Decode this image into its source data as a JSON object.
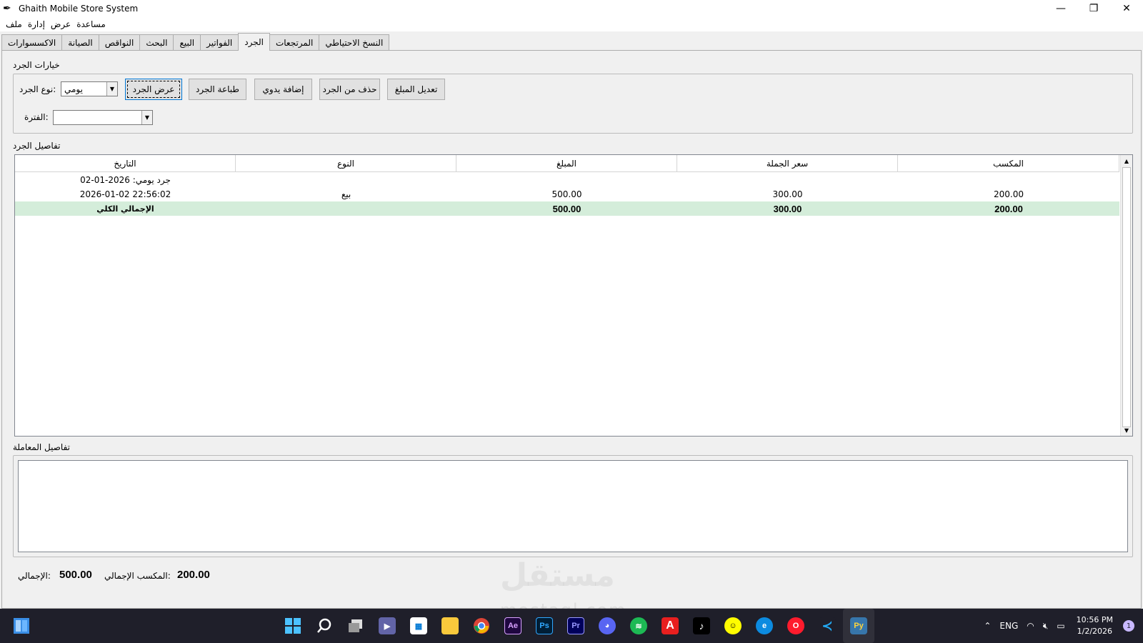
{
  "window": {
    "title": "Ghaith Mobile Store System"
  },
  "menu": [
    "ملف",
    "إدارة",
    "عرض",
    "مساعدة"
  ],
  "tabs": [
    "الاكسسوارات",
    "الصيانة",
    "النواقص",
    "البحث",
    "البيع",
    "الفواتير",
    "الجرد",
    "المرتجعات",
    "النسخ الاحتياطي"
  ],
  "options": {
    "group_label": "خيارات الجرد",
    "type_label": "نوع الجرد:",
    "type_value": "يومي",
    "period_label": "الفترة:",
    "period_value": "",
    "buttons": {
      "view": "عرض الجرد",
      "print": "طباعة الجرد",
      "add": "إضافة يدوي",
      "delete": "حذف من الجرد",
      "edit": "تعديل المبلغ"
    }
  },
  "details": {
    "group_label": "تفاصيل الجرد",
    "columns": [
      "التاريخ",
      "النوع",
      "المبلغ",
      "سعر الجملة",
      "المكسب"
    ],
    "rows": [
      {
        "date": "جرد يومي: 2026-01-02",
        "type": "",
        "amount": "",
        "wholesale": "",
        "profit": ""
      },
      {
        "date": "2026-01-02 22:56:02",
        "type": "بيع",
        "amount": "500.00",
        "wholesale": "300.00",
        "profit": "200.00"
      }
    ],
    "total": {
      "date": "الإجمالي الكلي",
      "type": "",
      "amount": "500.00",
      "wholesale": "300.00",
      "profit": "200.00"
    }
  },
  "transaction": {
    "group_label": "تفاصيل المعاملة"
  },
  "summary": {
    "total_label": "الإجمالي:",
    "total_value": "500.00",
    "profit_label": "المكسب الإجمالي:",
    "profit_value": "200.00"
  },
  "watermark": {
    "arabic": "مستقل",
    "latin": "mostaql.com"
  },
  "taskbar": {
    "tray_lang": "ENG",
    "time": "10:56 PM",
    "date": "1/2/2026",
    "notifications": "1"
  }
}
